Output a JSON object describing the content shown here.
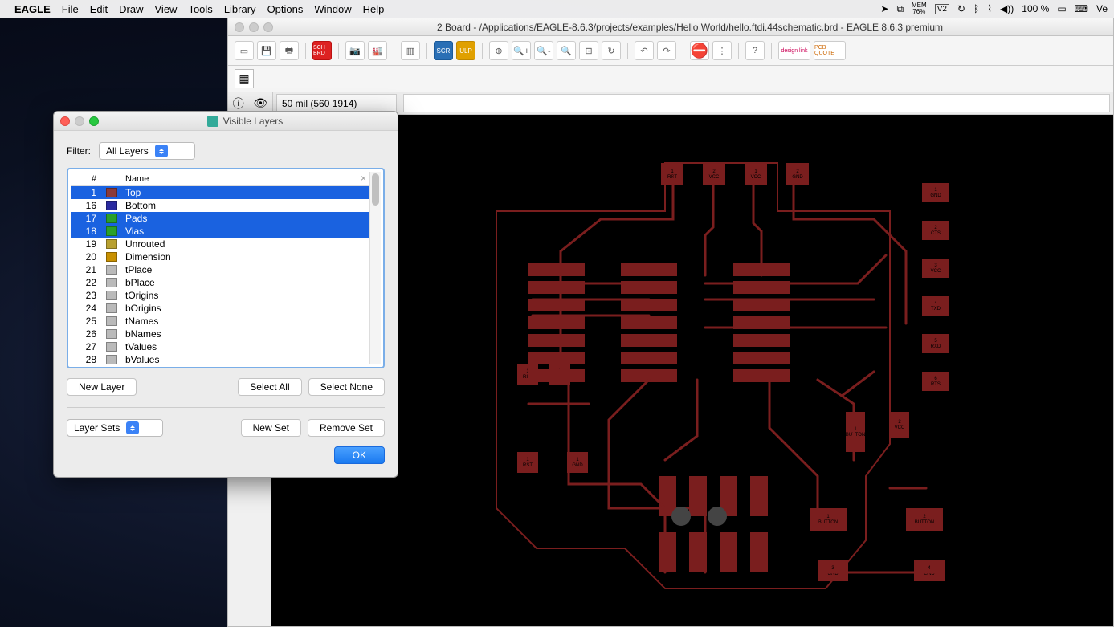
{
  "menubar": {
    "app": "EAGLE",
    "items": [
      "File",
      "Edit",
      "Draw",
      "View",
      "Tools",
      "Library",
      "Options",
      "Window",
      "Help"
    ],
    "mem_label": "MEM",
    "mem_pct": "76%",
    "battery": "100 %",
    "right_text": "Ve"
  },
  "window": {
    "title": "2 Board - /Applications/EAGLE-8.6.3/projects/examples/Hello World/hello.ftdi.44schematic.brd - EAGLE 8.6.3 premium",
    "coord": "50 mil (560 1914)",
    "toolbar": {
      "sch_brd": "SCH BRD",
      "scr": "SCR",
      "ulp": "ULP",
      "design_link": "design link",
      "pcb_quote": "PCB QUOTE"
    }
  },
  "dialog": {
    "title": "Visible Layers",
    "filter_label": "Filter:",
    "filter_value": "All Layers",
    "col_num": "#",
    "col_name": "Name",
    "layers": [
      {
        "num": 1,
        "name": "Top",
        "color": "#8a3a3a",
        "sel": true
      },
      {
        "num": 16,
        "name": "Bottom",
        "color": "#2a2aa0",
        "sel": false
      },
      {
        "num": 17,
        "name": "Pads",
        "color": "#2aa02a",
        "sel": true
      },
      {
        "num": 18,
        "name": "Vias",
        "color": "#2aa02a",
        "sel": true
      },
      {
        "num": 19,
        "name": "Unrouted",
        "color": "#b8a030",
        "sel": false
      },
      {
        "num": 20,
        "name": "Dimension",
        "color": "#c89000",
        "sel": false
      },
      {
        "num": 21,
        "name": "tPlace",
        "color": "#bababa",
        "sel": false
      },
      {
        "num": 22,
        "name": "bPlace",
        "color": "#bababa",
        "sel": false
      },
      {
        "num": 23,
        "name": "tOrigins",
        "color": "#bababa",
        "sel": false
      },
      {
        "num": 24,
        "name": "bOrigins",
        "color": "#bababa",
        "sel": false
      },
      {
        "num": 25,
        "name": "tNames",
        "color": "#bababa",
        "sel": false
      },
      {
        "num": 26,
        "name": "bNames",
        "color": "#bababa",
        "sel": false
      },
      {
        "num": 27,
        "name": "tValues",
        "color": "#bababa",
        "sel": false
      },
      {
        "num": 28,
        "name": "bValues",
        "color": "#bababa",
        "sel": false
      }
    ],
    "new_layer": "New Layer",
    "select_all": "Select All",
    "select_none": "Select None",
    "layer_sets": "Layer Sets",
    "new_set": "New Set",
    "remove_set": "Remove Set",
    "ok": "OK"
  },
  "pcb": {
    "top_pads": [
      {
        "t1": "1",
        "t2": "RST"
      },
      {
        "t1": "2",
        "t2": "VCC"
      },
      {
        "t1": "1",
        "t2": "VCC"
      },
      {
        "t1": "2",
        "t2": "GND"
      }
    ],
    "right_pads": [
      {
        "t1": "1",
        "t2": "GND"
      },
      {
        "t1": "2",
        "t2": "CTS"
      },
      {
        "t1": "3",
        "t2": "VCC"
      },
      {
        "t1": "4",
        "t2": "TXD"
      },
      {
        "t1": "5",
        "t2": "RXD"
      },
      {
        "t1": "6",
        "t2": "RTS"
      }
    ],
    "left_pads": [
      {
        "t1": "1",
        "t2": "RST"
      },
      {
        "t1": "2",
        "t2": "LED"
      },
      {
        "t1": "1",
        "t2": "RST"
      },
      {
        "t1": "1",
        "t2": "GND"
      }
    ],
    "button_right": {
      "t1": "1",
      "t2": "BUTTON"
    },
    "vcc_right": {
      "t1": "2",
      "t2": "VCC"
    },
    "bottom_buttons": [
      {
        "t1": "1",
        "t2": "BUTTON"
      },
      {
        "t1": "2",
        "t2": "BUTTON"
      }
    ],
    "bottom_gnd": [
      {
        "t1": "3",
        "t2": "GND"
      },
      {
        "t1": "4",
        "t2": "GND"
      }
    ]
  }
}
